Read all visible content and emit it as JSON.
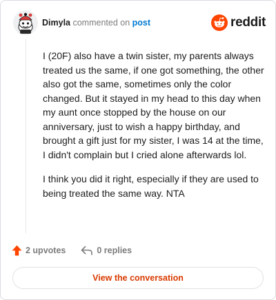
{
  "header": {
    "username": "Dimyla",
    "action_text": "commented on",
    "post_link": "post",
    "brand": "reddit"
  },
  "comment": {
    "paragraphs": [
      "I (20F) also have a twin sister, my parents always treated us the same, if one got something, the other also got the same, sometimes only the color changed. But it stayed in my head to this day when my aunt once stopped by the house on our anniversary, just to wish a happy birthday, and brought a gift just for my sister, I was 14 at the time, I didn't complain but I cried alone afterwards lol.",
      "I think you did it right, especially if they are used to being treated the same way. NTA"
    ]
  },
  "actions": {
    "upvotes": "2 upvotes",
    "replies": "0 replies"
  },
  "cta": {
    "label": "View the conversation"
  },
  "colors": {
    "brand_orange": "#ff4500",
    "link_blue": "#0079d3",
    "cta_text": "#d93a00",
    "muted": "#7c7c7c"
  },
  "icons": {
    "avatar": "snoo-avatar",
    "brand": "reddit-snoo-icon",
    "upvote": "upvote-arrow-icon",
    "reply": "reply-arrow-icon"
  }
}
